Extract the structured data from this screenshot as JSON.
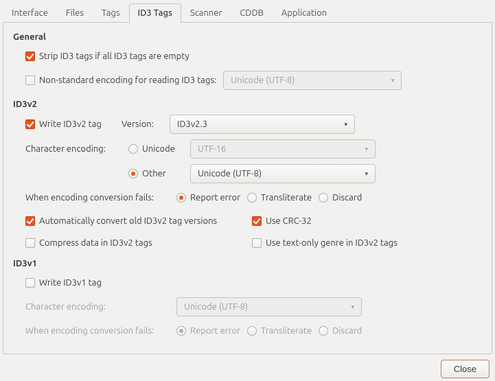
{
  "tabs": [
    "Interface",
    "Files",
    "Tags",
    "ID3 Tags",
    "Scanner",
    "CDDB",
    "Application"
  ],
  "active_tab": "ID3 Tags",
  "general": {
    "title": "General",
    "strip_label": "Strip ID3 tags if all ID3 tags are empty",
    "nonstd_label": "Non-standard encoding for reading ID3 tags:",
    "nonstd_select": "Unicode (UTF-8)"
  },
  "id3v2": {
    "title": "ID3v2",
    "write_label": "Write ID3v2 tag",
    "version_label": "Version:",
    "version_value": "ID3v2.3",
    "char_enc_label": "Character encoding:",
    "unicode_label": "Unicode",
    "unicode_select": "UTF-16",
    "other_label": "Other",
    "other_select": "Unicode (UTF-8)",
    "fail_label": "When encoding conversion fails:",
    "fail_report": "Report error",
    "fail_translit": "Transliterate",
    "fail_discard": "Discard",
    "autoconv_label": "Automatically convert old ID3v2 tag versions",
    "crc_label": "Use CRC-32",
    "compress_label": "Compress data in ID3v2 tags",
    "textgenre_label": "Use text-only genre in ID3v2 tags"
  },
  "id3v1": {
    "title": "ID3v1",
    "write_label": "Write ID3v1 tag",
    "char_enc_label": "Character encoding:",
    "char_enc_value": "Unicode (UTF-8)",
    "fail_label": "When encoding conversion fails:",
    "fail_report": "Report error",
    "fail_translit": "Transliterate",
    "fail_discard": "Discard"
  },
  "close": "Close"
}
